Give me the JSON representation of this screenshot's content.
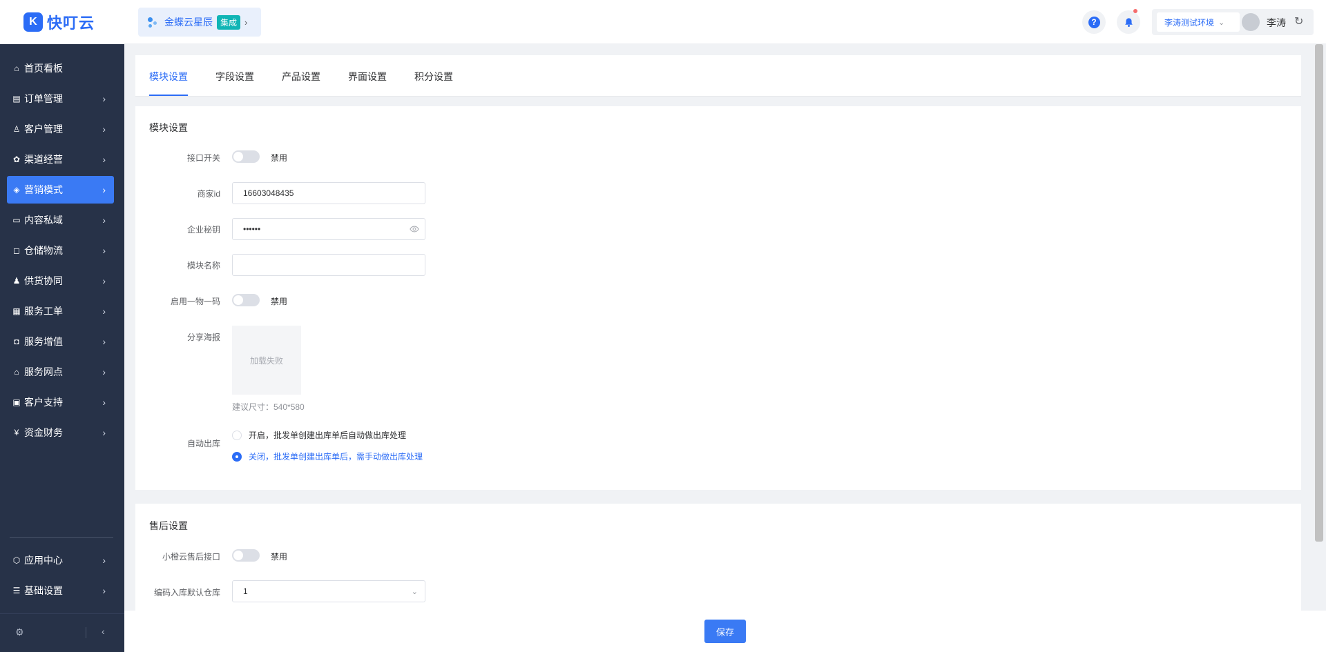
{
  "app": {
    "logo_mark": "K",
    "logo_text": "快叮云",
    "integration_name": "金蝶云星辰",
    "integration_tag": "集成",
    "help_glyph": "?",
    "env_label": "李涛测试环境",
    "user_name": "李涛"
  },
  "sidebar": {
    "items": [
      {
        "label": "首页看板",
        "icon": "home-icon"
      },
      {
        "label": "订单管理",
        "icon": "order-icon"
      },
      {
        "label": "客户管理",
        "icon": "user-icon"
      },
      {
        "label": "渠道经营",
        "icon": "channel-icon"
      },
      {
        "label": "营销模式",
        "icon": "tag-icon"
      },
      {
        "label": "内容私域",
        "icon": "image-icon"
      },
      {
        "label": "仓储物流",
        "icon": "box-icon"
      },
      {
        "label": "供货协同",
        "icon": "supply-icon"
      },
      {
        "label": "服务工单",
        "icon": "ticket-icon"
      },
      {
        "label": "服务增值",
        "icon": "bag-icon"
      },
      {
        "label": "服务网点",
        "icon": "store-icon"
      },
      {
        "label": "客户支持",
        "icon": "support-icon"
      },
      {
        "label": "资金财务",
        "icon": "yuan-icon"
      },
      {
        "label": "应用中心",
        "icon": "cube-icon"
      },
      {
        "label": "基础设置",
        "icon": "settings-icon"
      }
    ],
    "active_label": "营销模式"
  },
  "tabs": [
    "模块设置",
    "字段设置",
    "产品设置",
    "界面设置",
    "积分设置"
  ],
  "active_tab": "模块设置",
  "module_settings": {
    "title": "模块设置",
    "api_switch_label": "接口开关",
    "api_switch_state": "禁用",
    "merchant_id_label": "商家id",
    "merchant_id_value": "16603048435",
    "secret_label": "企业秘钥",
    "secret_value": "••••••",
    "module_name_label": "模块名称",
    "module_name_value": "",
    "one_code_label": "启用一物一码",
    "one_code_state": "禁用",
    "poster_label": "分享海报",
    "poster_status": "加载失败",
    "poster_hint": "建议尺寸：540*580",
    "auto_out_label": "自动出库",
    "auto_out_options": [
      "开启，批发单创建出库单后自动做出库处理",
      "关闭，批发单创建出库单后，需手动做出库处理"
    ],
    "auto_out_selected": 1
  },
  "after_sales": {
    "title": "售后设置",
    "api_label": "小橙云售后接口",
    "api_state": "禁用",
    "warehouse_label": "编码入库默认仓库",
    "warehouse_value": "1"
  },
  "footer": {
    "save_label": "保存"
  },
  "colors": {
    "accent": "#2b6cf6",
    "sidebar_bg": "#273248",
    "active_nav": "#3a7af4"
  }
}
